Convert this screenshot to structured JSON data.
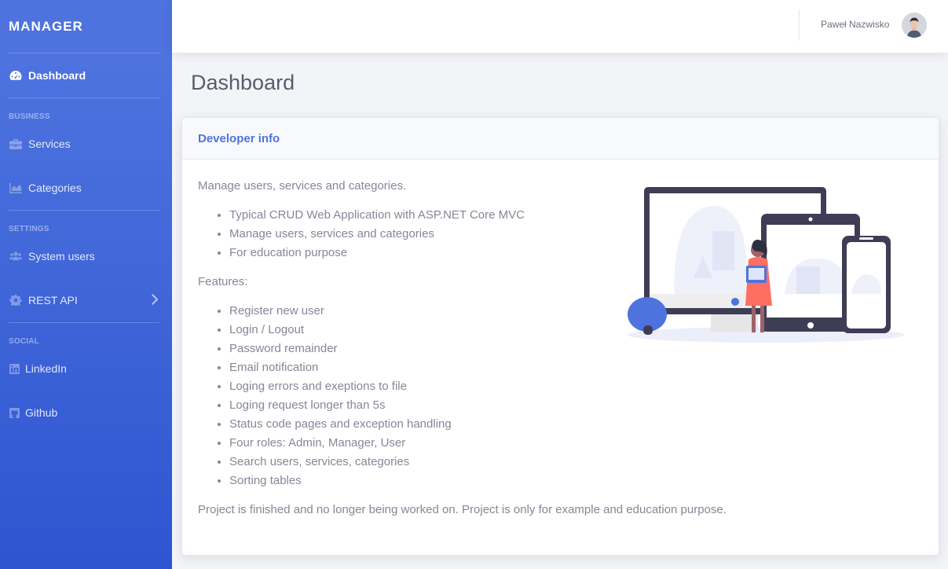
{
  "sidebar": {
    "brand": "MANAGER",
    "dashboard": "Dashboard",
    "headings": {
      "business": "BUSINESS",
      "settings": "SETTINGS",
      "social": "SOCIAL"
    },
    "items": {
      "services": "Services",
      "categories": "Categories",
      "system_users": "System users",
      "rest_api": "REST API",
      "linkedin": "LinkedIn",
      "github": "Github"
    }
  },
  "topbar": {
    "username": "Paweł Nazwisko"
  },
  "page": {
    "title": "Dashboard"
  },
  "card": {
    "header": "Developer info",
    "intro": "Manage users, services and categories.",
    "summary": [
      "Typical CRUD Web Application with ASP.NET Core MVC",
      "Manage users, services and categories",
      "For education purpose"
    ],
    "features_label": "Features:",
    "features": [
      "Register new user",
      "Login / Logout",
      "Password remainder",
      "Email notification",
      "Loging errors and exeptions to file",
      "Loging request longer than 5s",
      "Status code pages and exception handling",
      "Four roles: Admin, Manager, User",
      "Search users, services, categories",
      "Sorting tables"
    ],
    "footer": "Project is finished and no longer being worked on. Project is only for example and education purpose."
  },
  "colors": {
    "primary": "#4e73df",
    "text": "#858796",
    "heading": "#5a5c69"
  },
  "icons": [
    "tachometer-icon",
    "briefcase-icon",
    "chart-area-icon",
    "users-icon",
    "cog-icon",
    "chevron-right-icon",
    "linkedin-icon",
    "github-icon"
  ]
}
